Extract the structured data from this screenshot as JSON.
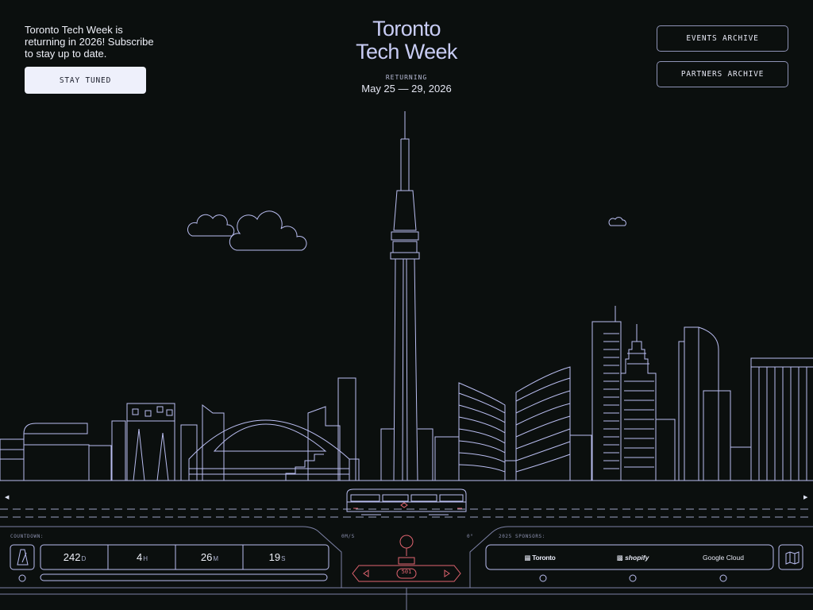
{
  "intro": {
    "text": "Toronto Tech Week is returning in 2026! Subscribe to stay up to date.",
    "cta_label": "STAY TUNED"
  },
  "brand": {
    "title_line1": "Toronto",
    "title_line2": "Tech Week",
    "returning_label": "RETURNING",
    "dates": "May 25 — 29, 2026"
  },
  "nav": {
    "events_archive": "EVENTS ARCHIVE",
    "partners_archive": "PARTNERS ARCHIVE"
  },
  "dashboard": {
    "countdown_label": "COUNTDOWN:",
    "countdown": [
      {
        "value": "242",
        "unit": "D"
      },
      {
        "value": "4",
        "unit": "H"
      },
      {
        "value": "26",
        "unit": "M"
      },
      {
        "value": "19",
        "unit": "S"
      }
    ],
    "speed_label": "0M/S",
    "angle_label": "0°",
    "tram_number": "501",
    "sponsors_label": "2025 SPONSORS:",
    "sponsors": [
      "Toronto",
      "shopify",
      "Google Cloud"
    ]
  },
  "icons": {
    "metronome": "metronome-icon",
    "map": "map-icon",
    "left_arrow": "arrow-left-icon",
    "right_arrow": "arrow-right-icon"
  },
  "colors": {
    "background": "#0b0f0e",
    "line": "#b9bdf0",
    "accent_red": "#e06470",
    "button_fill": "#eef0fb"
  }
}
